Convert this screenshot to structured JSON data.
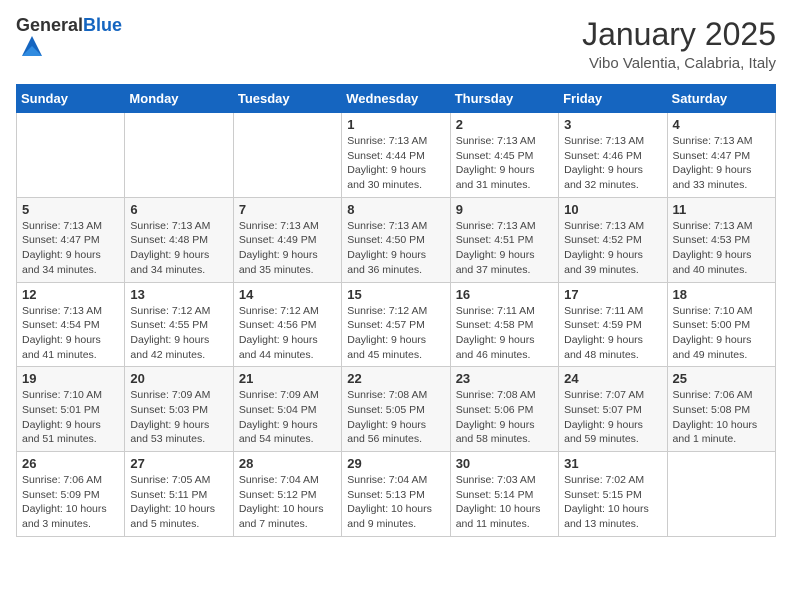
{
  "header": {
    "logo_general": "General",
    "logo_blue": "Blue",
    "month_title": "January 2025",
    "location": "Vibo Valentia, Calabria, Italy"
  },
  "weekdays": [
    "Sunday",
    "Monday",
    "Tuesday",
    "Wednesday",
    "Thursday",
    "Friday",
    "Saturday"
  ],
  "weeks": [
    [
      {
        "day": "",
        "info": ""
      },
      {
        "day": "",
        "info": ""
      },
      {
        "day": "",
        "info": ""
      },
      {
        "day": "1",
        "info": "Sunrise: 7:13 AM\nSunset: 4:44 PM\nDaylight: 9 hours\nand 30 minutes."
      },
      {
        "day": "2",
        "info": "Sunrise: 7:13 AM\nSunset: 4:45 PM\nDaylight: 9 hours\nand 31 minutes."
      },
      {
        "day": "3",
        "info": "Sunrise: 7:13 AM\nSunset: 4:46 PM\nDaylight: 9 hours\nand 32 minutes."
      },
      {
        "day": "4",
        "info": "Sunrise: 7:13 AM\nSunset: 4:47 PM\nDaylight: 9 hours\nand 33 minutes."
      }
    ],
    [
      {
        "day": "5",
        "info": "Sunrise: 7:13 AM\nSunset: 4:47 PM\nDaylight: 9 hours\nand 34 minutes."
      },
      {
        "day": "6",
        "info": "Sunrise: 7:13 AM\nSunset: 4:48 PM\nDaylight: 9 hours\nand 34 minutes."
      },
      {
        "day": "7",
        "info": "Sunrise: 7:13 AM\nSunset: 4:49 PM\nDaylight: 9 hours\nand 35 minutes."
      },
      {
        "day": "8",
        "info": "Sunrise: 7:13 AM\nSunset: 4:50 PM\nDaylight: 9 hours\nand 36 minutes."
      },
      {
        "day": "9",
        "info": "Sunrise: 7:13 AM\nSunset: 4:51 PM\nDaylight: 9 hours\nand 37 minutes."
      },
      {
        "day": "10",
        "info": "Sunrise: 7:13 AM\nSunset: 4:52 PM\nDaylight: 9 hours\nand 39 minutes."
      },
      {
        "day": "11",
        "info": "Sunrise: 7:13 AM\nSunset: 4:53 PM\nDaylight: 9 hours\nand 40 minutes."
      }
    ],
    [
      {
        "day": "12",
        "info": "Sunrise: 7:13 AM\nSunset: 4:54 PM\nDaylight: 9 hours\nand 41 minutes."
      },
      {
        "day": "13",
        "info": "Sunrise: 7:12 AM\nSunset: 4:55 PM\nDaylight: 9 hours\nand 42 minutes."
      },
      {
        "day": "14",
        "info": "Sunrise: 7:12 AM\nSunset: 4:56 PM\nDaylight: 9 hours\nand 44 minutes."
      },
      {
        "day": "15",
        "info": "Sunrise: 7:12 AM\nSunset: 4:57 PM\nDaylight: 9 hours\nand 45 minutes."
      },
      {
        "day": "16",
        "info": "Sunrise: 7:11 AM\nSunset: 4:58 PM\nDaylight: 9 hours\nand 46 minutes."
      },
      {
        "day": "17",
        "info": "Sunrise: 7:11 AM\nSunset: 4:59 PM\nDaylight: 9 hours\nand 48 minutes."
      },
      {
        "day": "18",
        "info": "Sunrise: 7:10 AM\nSunset: 5:00 PM\nDaylight: 9 hours\nand 49 minutes."
      }
    ],
    [
      {
        "day": "19",
        "info": "Sunrise: 7:10 AM\nSunset: 5:01 PM\nDaylight: 9 hours\nand 51 minutes."
      },
      {
        "day": "20",
        "info": "Sunrise: 7:09 AM\nSunset: 5:03 PM\nDaylight: 9 hours\nand 53 minutes."
      },
      {
        "day": "21",
        "info": "Sunrise: 7:09 AM\nSunset: 5:04 PM\nDaylight: 9 hours\nand 54 minutes."
      },
      {
        "day": "22",
        "info": "Sunrise: 7:08 AM\nSunset: 5:05 PM\nDaylight: 9 hours\nand 56 minutes."
      },
      {
        "day": "23",
        "info": "Sunrise: 7:08 AM\nSunset: 5:06 PM\nDaylight: 9 hours\nand 58 minutes."
      },
      {
        "day": "24",
        "info": "Sunrise: 7:07 AM\nSunset: 5:07 PM\nDaylight: 9 hours\nand 59 minutes."
      },
      {
        "day": "25",
        "info": "Sunrise: 7:06 AM\nSunset: 5:08 PM\nDaylight: 10 hours\nand 1 minute."
      }
    ],
    [
      {
        "day": "26",
        "info": "Sunrise: 7:06 AM\nSunset: 5:09 PM\nDaylight: 10 hours\nand 3 minutes."
      },
      {
        "day": "27",
        "info": "Sunrise: 7:05 AM\nSunset: 5:11 PM\nDaylight: 10 hours\nand 5 minutes."
      },
      {
        "day": "28",
        "info": "Sunrise: 7:04 AM\nSunset: 5:12 PM\nDaylight: 10 hours\nand 7 minutes."
      },
      {
        "day": "29",
        "info": "Sunrise: 7:04 AM\nSunset: 5:13 PM\nDaylight: 10 hours\nand 9 minutes."
      },
      {
        "day": "30",
        "info": "Sunrise: 7:03 AM\nSunset: 5:14 PM\nDaylight: 10 hours\nand 11 minutes."
      },
      {
        "day": "31",
        "info": "Sunrise: 7:02 AM\nSunset: 5:15 PM\nDaylight: 10 hours\nand 13 minutes."
      },
      {
        "day": "",
        "info": ""
      }
    ]
  ]
}
